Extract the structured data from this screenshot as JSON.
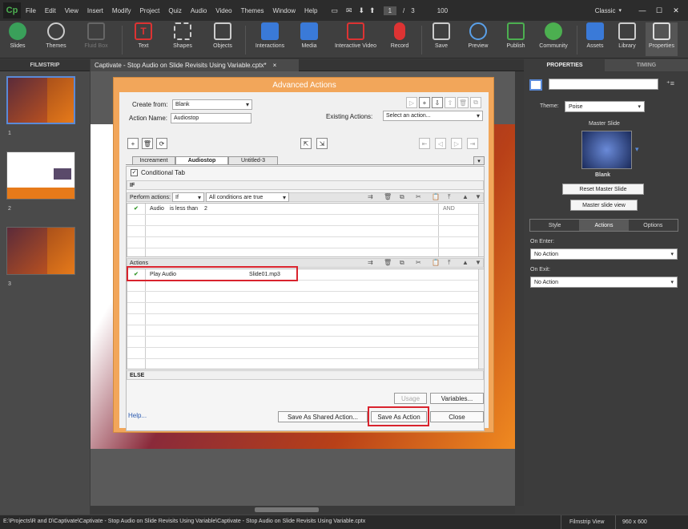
{
  "app": {
    "logo": "Cp",
    "menus": [
      "File",
      "Edit",
      "View",
      "Insert",
      "Modify",
      "Project",
      "Quiz",
      "Audio",
      "Video",
      "Themes",
      "Window",
      "Help"
    ],
    "page_current": "1",
    "page_sep": "/",
    "page_total": "3",
    "zoom": "100",
    "workspace": "Classic"
  },
  "toolbar": {
    "items": [
      "Slides",
      "Themes",
      "Fluid Box",
      "Text",
      "Shapes",
      "Objects",
      "Interactions",
      "Media",
      "Interactive Video",
      "Record",
      "Save",
      "Preview",
      "Publish",
      "Community",
      "Assets",
      "Library",
      "Properties"
    ]
  },
  "filmstrip": {
    "header": "FILMSTRIP",
    "slides": [
      {
        "num": "1"
      },
      {
        "num": "2"
      },
      {
        "num": "3"
      }
    ]
  },
  "document": {
    "tab": "Captivate - Stop Audio on Slide Revisits Using Variable.cptx*",
    "close": "×"
  },
  "properties": {
    "tab_properties": "PROPERTIES",
    "tab_timing": "TIMING",
    "theme_label": "Theme:",
    "theme_value": "Poise",
    "master_slide_label": "Master Slide",
    "master_name": "Blank",
    "reset_btn": "Reset Master Slide",
    "view_btn": "Master slide view",
    "subtabs": [
      "Style",
      "Actions",
      "Options"
    ],
    "on_enter_label": "On Enter:",
    "on_enter_value": "No Action",
    "on_exit_label": "On Exit:",
    "on_exit_value": "No Action"
  },
  "status": {
    "path": "E:\\Projects\\R and D\\Captivate\\Captivate - Stop Audio on Slide Revisits Using Variable\\Captivate - Stop Audio on Slide Revisits Using Variable.cptx",
    "view": "Filmstrip View",
    "size": "960 x 600"
  },
  "dialog": {
    "title": "Advanced Actions",
    "create_from_label": "Create from:",
    "create_from_value": "Blank",
    "action_name_label": "Action Name:",
    "action_name_value": "Audiostop",
    "existing_label": "Existing Actions:",
    "existing_value": "Select an action...",
    "tabs": [
      "Increament",
      "Audiostop",
      "Untitled-3"
    ],
    "conditional_tab": "Conditional Tab",
    "if_label": "IF",
    "perform_label": "Perform actions:",
    "perform_value": "If",
    "conditions_value": "All conditions are true",
    "condition": {
      "var": "Audio",
      "op": "is less than",
      "value": "2",
      "logic": "AND"
    },
    "actions_label": "Actions",
    "action_row": {
      "command": "Play Audio",
      "target": "Slide01.mp3"
    },
    "else_label": "ELSE",
    "help": "Help...",
    "usage_btn": "Usage",
    "variables_btn": "Variables...",
    "shared_btn": "Save As Shared Action...",
    "save_btn": "Save As Action",
    "close_btn": "Close"
  }
}
